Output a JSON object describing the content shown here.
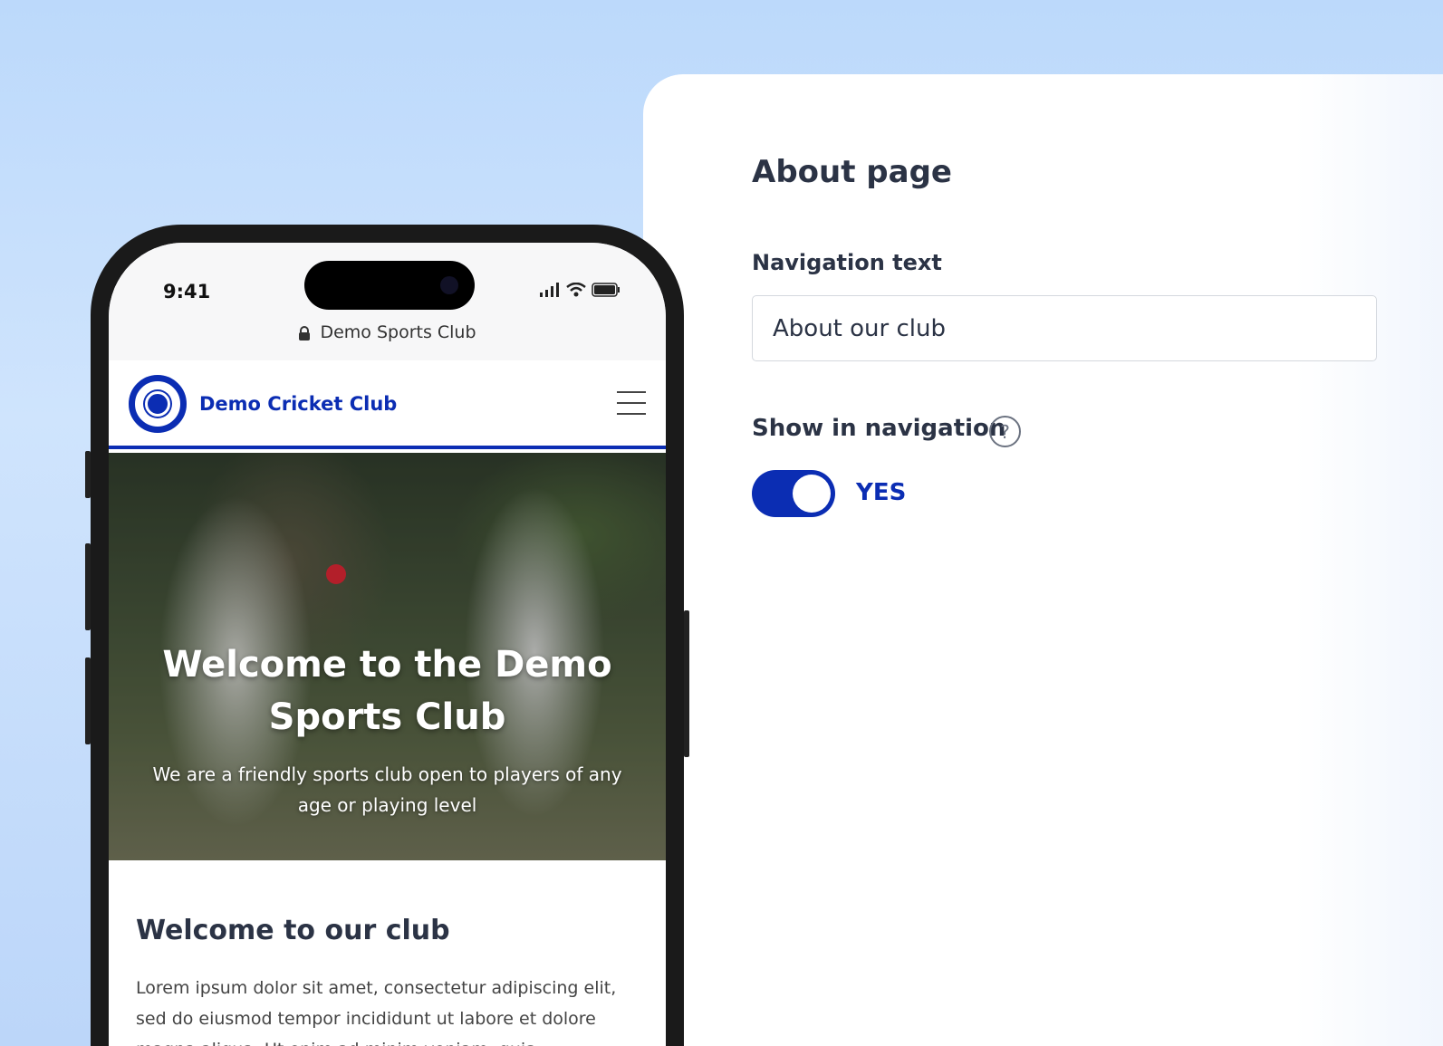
{
  "settings": {
    "title": "About page",
    "navigation_text_label": "Navigation text",
    "navigation_text_value": "About our club",
    "show_in_navigation_label": "Show in navigation",
    "help_icon": "question-circle-icon",
    "toggle_state_text": "YES",
    "accent_color": "#0b2db3"
  },
  "phone": {
    "time": "9:41",
    "url": "Demo Sports Club",
    "site": {
      "club_name": "Demo Cricket Club",
      "hero_title": "Welcome to the Demo Sports Club",
      "hero_subtitle": "We are a friendly sports club open to players of any age or playing level",
      "section_title": "Welcome to our club",
      "section_body": "Lorem ipsum dolor sit amet, consectetur adipiscing elit, sed do eiusmod tempor incididunt ut labore et dolore magna aliqua. Ut enim ad minim veniam, quis"
    }
  }
}
